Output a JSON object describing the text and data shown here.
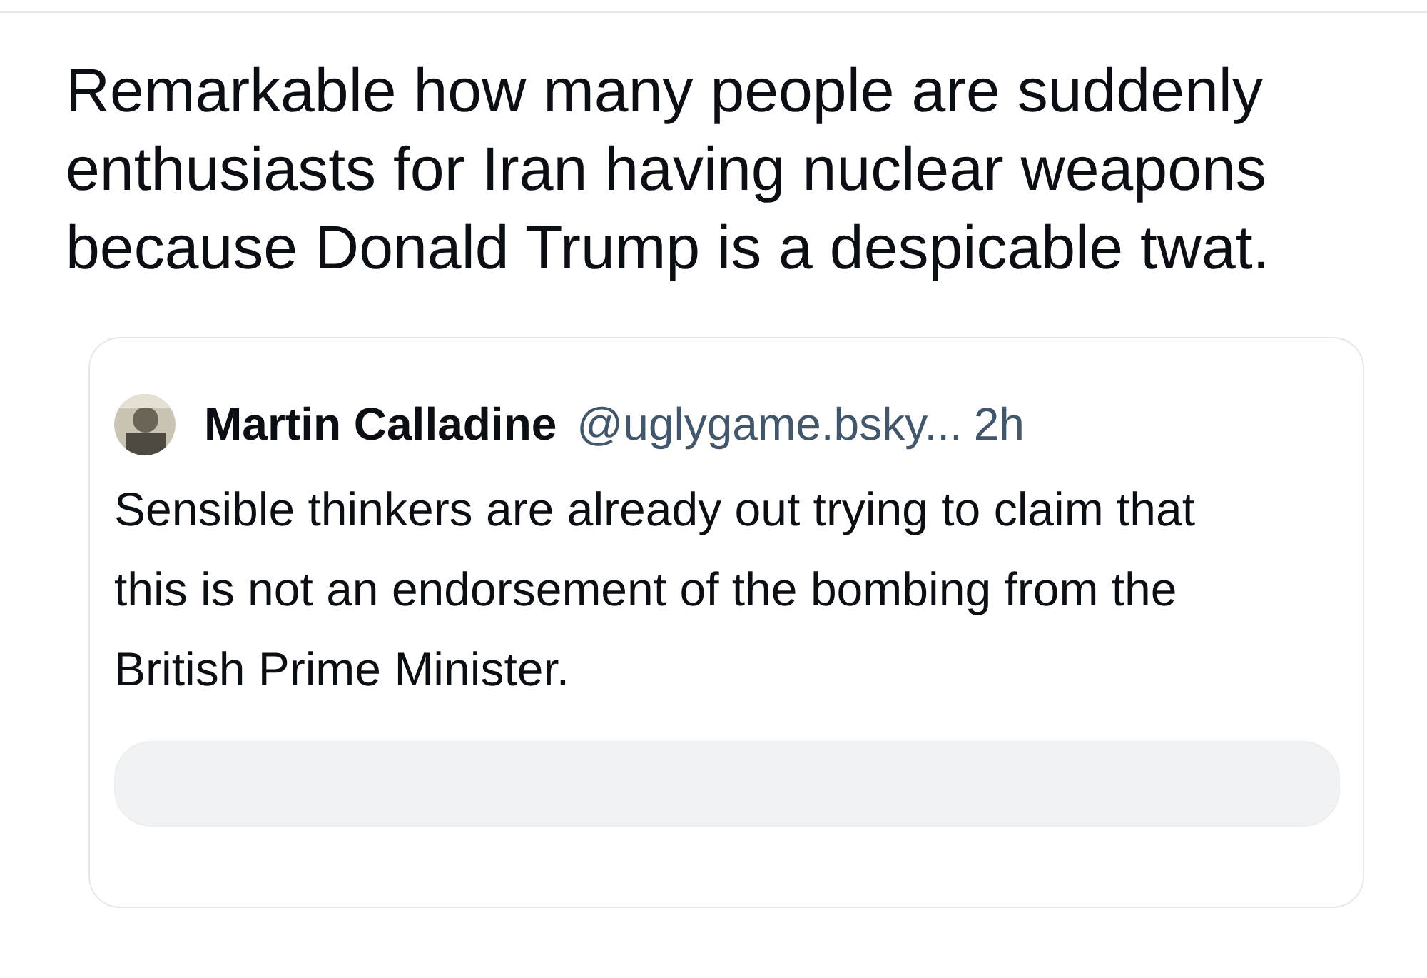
{
  "post": {
    "text": "Remarkable how many people are suddenly enthusiasts for Iran having nuclear weapons because Donald Trump is a despicable twat."
  },
  "quoted_post": {
    "author_name": "Martin Calladine",
    "handle": "@uglygame.bsky...",
    "time": "2h",
    "text": "Sensible thinkers are already out trying to claim that this is not an endorsement of the bombing from the British Prime Minister.",
    "embed": {
      "kind": "card"
    }
  }
}
